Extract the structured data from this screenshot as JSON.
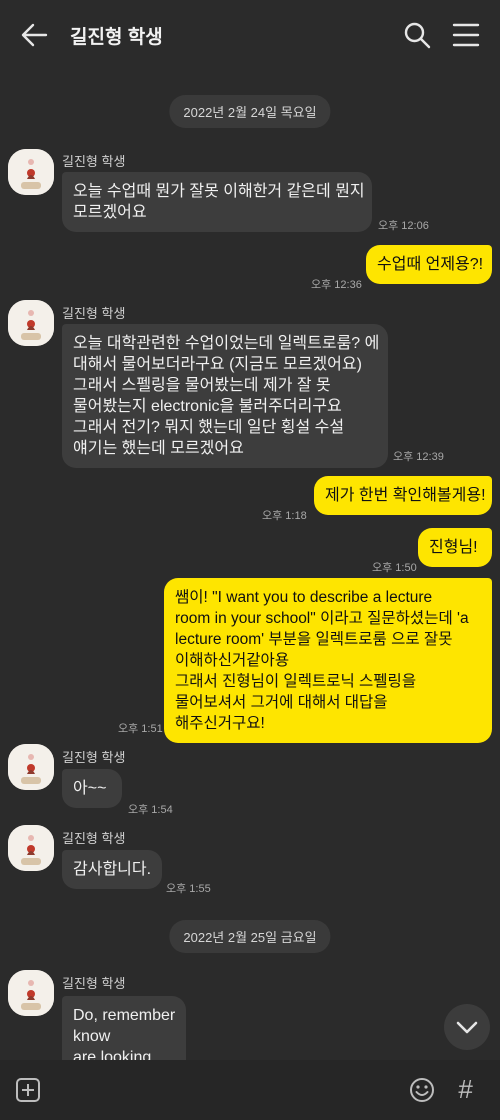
{
  "header": {
    "title": "길진형 학생"
  },
  "dates": [
    "2022년 2월 24일 목요일",
    "2022년 2월 25일 금요일"
  ],
  "sender_name": "길진형 학생",
  "messages": [
    {
      "from": "them",
      "lines": [
        "오늘 수업때 뭔가 잘못 이해한거 같은데 뭔지",
        "모르겠어요"
      ],
      "time": "오후 12:06"
    },
    {
      "from": "me",
      "lines": [
        "수업때 언제용?!"
      ],
      "time": "오후 12:36"
    },
    {
      "from": "them",
      "lines": [
        "오늘 대학관련한 수업이었는데 일렉트로룸? 에",
        "대해서 물어보더라구요 (지금도 모르겠어요)",
        "그래서 스펠링을 물어봤는데 제가 잘 못",
        "물어봤는지 electronic을 불러주더리구요",
        "그래서 전기? 뭐지 했는데 일단 횡설 수설",
        "얘기는 했는데 모르겠어요"
      ],
      "time": "오후 12:39"
    },
    {
      "from": "me",
      "lines": [
        "제가 한번 확인해볼게용!"
      ],
      "time": "오후 1:18"
    },
    {
      "from": "me",
      "lines": [
        "진형님!"
      ],
      "time": "오후 1:50"
    },
    {
      "from": "me",
      "lines": [
        "쌤이! \"I want you to describe a lecture",
        "room in your school\" 이라고 질문하셨는데 'a",
        "lecture room' 부분을 일렉트로룸 으로 잘못",
        "이해하신거같아용",
        "그래서 진형님이 일렉트로닉 스펠링을",
        "물어보셔서 그거에 대해서 대답을",
        "해주신거구요!"
      ],
      "time": "오후 1:51"
    },
    {
      "from": "them",
      "lines": [
        "아~~"
      ],
      "time": "오후 1:54"
    },
    {
      "from": "them",
      "lines": [
        "감사합니다."
      ],
      "time": "오후 1:55"
    },
    {
      "from": "them",
      "lines": [
        "Do, remember",
        "know",
        "are looking"
      ],
      "time": ""
    }
  ]
}
